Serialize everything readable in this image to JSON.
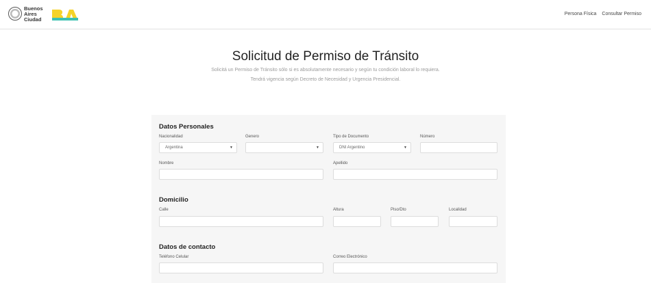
{
  "header": {
    "city_lines": [
      "Buenos",
      "Aires",
      "Ciudad"
    ],
    "nav": [
      "Persona Física",
      "Consultar Permiso"
    ]
  },
  "page": {
    "title": "Solicitud de Permiso de Tránsito",
    "subtitle_1": "Solicitá un Permiso de Tránsito sólo si es absolutamente necesario y según tu condición laboral lo requiera.",
    "subtitle_2": "Tendrá vigencia según Decreto de Necesidad y Urgencia Presidencial."
  },
  "personal": {
    "title": "Datos Personales",
    "nacionalidad_label": "Nacionalidad",
    "nacionalidad_value": "Argentina",
    "genero_label": "Genero",
    "genero_value": "",
    "tipo_doc_label": "Tipo de Documento",
    "tipo_doc_value": "DNI Argentino",
    "numero_label": "Número",
    "nombre_label": "Nombre",
    "apellido_label": "Apellido"
  },
  "domicilio": {
    "title": "Domicilio",
    "calle_label": "Calle",
    "altura_label": "Altura",
    "piso_label": "Piso/Dto",
    "localidad_label": "Localidad"
  },
  "contacto": {
    "title": "Datos de contacto",
    "telefono_label": "Teléfono Celular",
    "correo_label": "Correo Electrónico"
  },
  "icons": {
    "dropdown": "▼"
  },
  "colors": {
    "ba_yellow": "#f5d328",
    "ba_teal": "#3ec1b2",
    "panel_bg": "#f6f6f6"
  }
}
